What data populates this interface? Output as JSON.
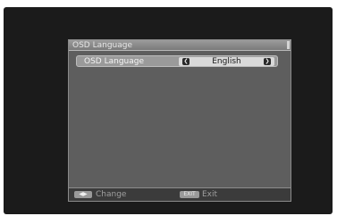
{
  "window": {
    "title": "OSD Language"
  },
  "menu": {
    "items": [
      {
        "label": "OSD Language",
        "value": "English",
        "left_arrow": "❮",
        "right_arrow": "❯"
      }
    ]
  },
  "footer": {
    "change_key": "◀▶",
    "change_label": "Change",
    "exit_key": "EXIT",
    "exit_label": "Exit"
  },
  "icons": {
    "left_arrow": "chevron-left-icon",
    "right_arrow": "chevron-right-icon",
    "change_key": "left-right-key-icon",
    "exit_key": "exit-key-icon"
  },
  "colors": {
    "screen_background": "#1b1b1b",
    "panel_background": "#5e5e5e",
    "highlight_row": "#9a9a9a",
    "value_box": "#d9d9d9"
  }
}
